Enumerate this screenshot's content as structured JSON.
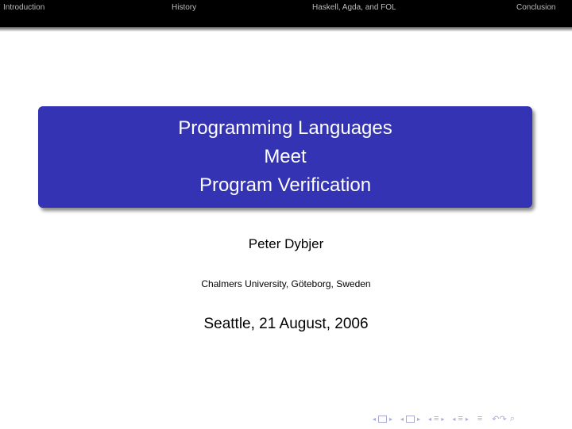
{
  "headline": {
    "sections": [
      {
        "label": "Introduction"
      },
      {
        "label": "History"
      },
      {
        "label": "Haskell, Agda, and FOL"
      },
      {
        "label": "Conclusion"
      }
    ]
  },
  "title": {
    "lines": [
      "Programming Languages",
      "Meet",
      "Program Verification"
    ]
  },
  "author": "Peter Dybjer",
  "institute": "Chalmers University, Göteborg, Sweden",
  "date": "Seattle, 21 August, 2006",
  "navigation": {
    "symbols": {
      "left": "◂",
      "right": "▸",
      "section": "≡",
      "back_forward": "↶↷",
      "search": "⌕"
    }
  },
  "colors": {
    "title_box": "#3333b3",
    "headline_bg": "#000000",
    "headline_text": "#bcbcbc",
    "nav_symbols": "#a9a9d8"
  }
}
